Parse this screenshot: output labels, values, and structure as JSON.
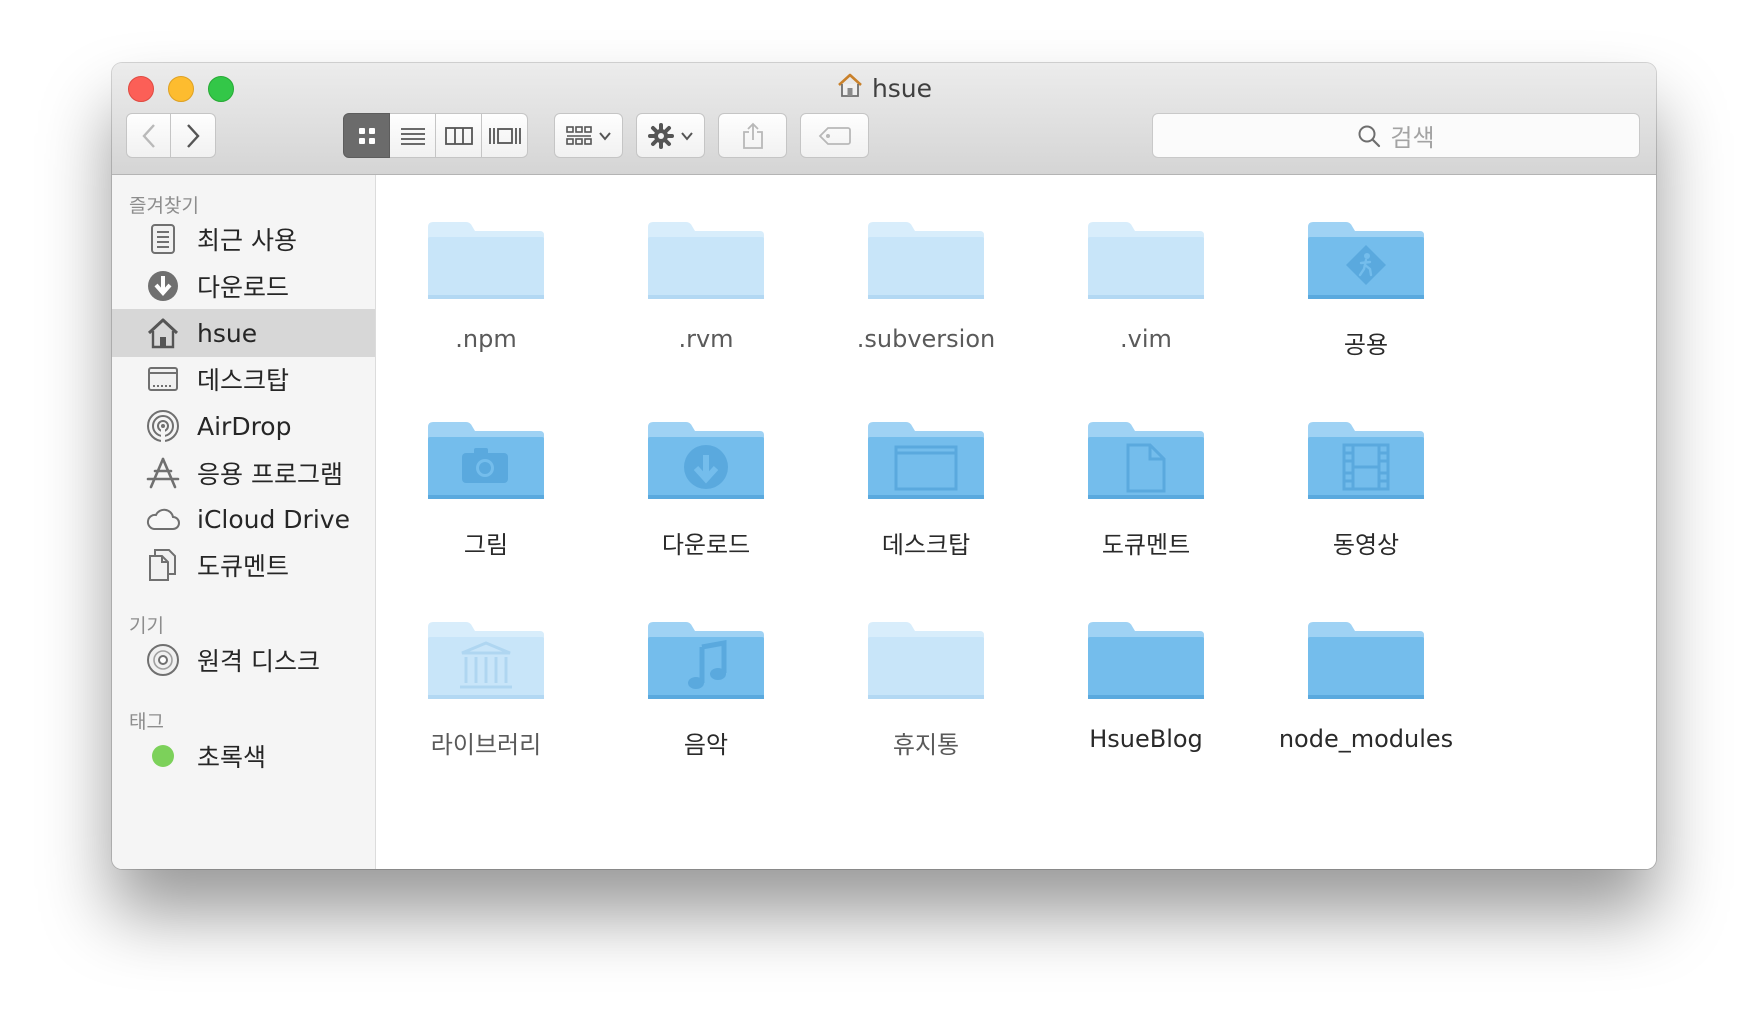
{
  "window": {
    "title": "hsue"
  },
  "toolbar": {
    "search_placeholder": "검색"
  },
  "sidebar": {
    "sections": [
      {
        "header": "즐겨찾기",
        "items": [
          {
            "label": "최근 사용",
            "icon": "recents-icon"
          },
          {
            "label": "다운로드",
            "icon": "download-icon"
          },
          {
            "label": "hsue",
            "icon": "home-icon",
            "selected": true
          },
          {
            "label": "데스크탑",
            "icon": "desktop-icon"
          },
          {
            "label": "AirDrop",
            "icon": "airdrop-icon"
          },
          {
            "label": "응용 프로그램",
            "icon": "applications-icon"
          },
          {
            "label": "iCloud Drive",
            "icon": "cloud-icon"
          },
          {
            "label": "도큐멘트",
            "icon": "documents-icon"
          }
        ]
      },
      {
        "header": "기기",
        "items": [
          {
            "label": "원격 디스크",
            "icon": "disc-icon"
          }
        ]
      },
      {
        "header": "태그",
        "items": [
          {
            "label": "초록색",
            "icon": "green-tag-icon",
            "color": "#7cd15a"
          }
        ]
      }
    ]
  },
  "files": [
    {
      "name": ".npm",
      "glyph": "none",
      "hidden": true
    },
    {
      "name": ".rvm",
      "glyph": "none",
      "hidden": true
    },
    {
      "name": ".subversion",
      "glyph": "none",
      "hidden": true
    },
    {
      "name": ".vim",
      "glyph": "none",
      "hidden": true
    },
    {
      "name": "공용",
      "glyph": "public-icon"
    },
    {
      "name": "그림",
      "glyph": "camera-icon"
    },
    {
      "name": "다운로드",
      "glyph": "download-icon"
    },
    {
      "name": "데스크탑",
      "glyph": "window-icon"
    },
    {
      "name": "도큐멘트",
      "glyph": "document-icon"
    },
    {
      "name": "동영상",
      "glyph": "film-icon"
    },
    {
      "name": "라이브러리",
      "glyph": "library-icon",
      "hidden": true
    },
    {
      "name": "음악",
      "glyph": "music-icon"
    },
    {
      "name": "휴지통",
      "glyph": "none",
      "hidden": true
    },
    {
      "name": "HsueBlog",
      "glyph": "none"
    },
    {
      "name": "node_modules",
      "glyph": "none"
    }
  ],
  "colors": {
    "folder": "#74bdec",
    "folder_light": "#c6e4f8",
    "selected_row": "#d7d7d7"
  }
}
